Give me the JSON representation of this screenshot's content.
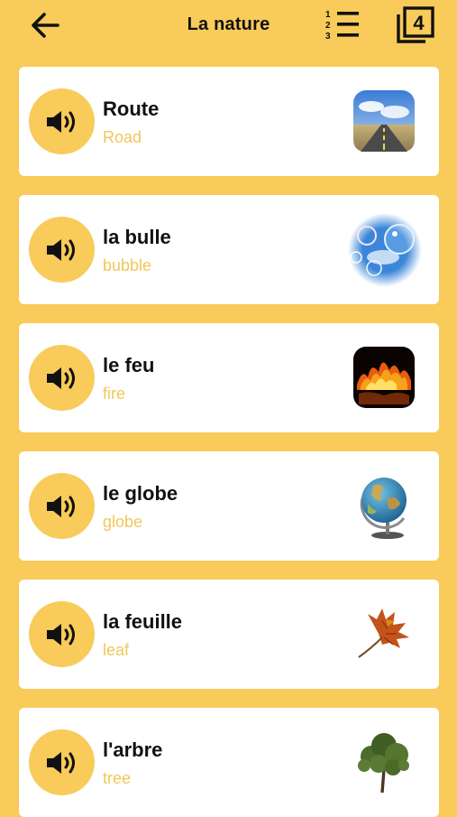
{
  "header": {
    "title": "La nature",
    "set_number": "4"
  },
  "items": [
    {
      "word": "Route",
      "translation": "Road",
      "image": "road-image"
    },
    {
      "word": "la bulle",
      "translation": "bubble",
      "image": "bubble-image"
    },
    {
      "word": "le feu",
      "translation": "fire",
      "image": "fire-image"
    },
    {
      "word": "le globe",
      "translation": "globe",
      "image": "globe-image"
    },
    {
      "word": "la feuille",
      "translation": "leaf",
      "image": "leaf-image"
    },
    {
      "word": "l'arbre",
      "translation": "tree",
      "image": "tree-image"
    }
  ],
  "colors": {
    "background": "#F8CB5A",
    "card": "#FFFFFF",
    "translation": "#F0C75A",
    "text": "#111111"
  }
}
